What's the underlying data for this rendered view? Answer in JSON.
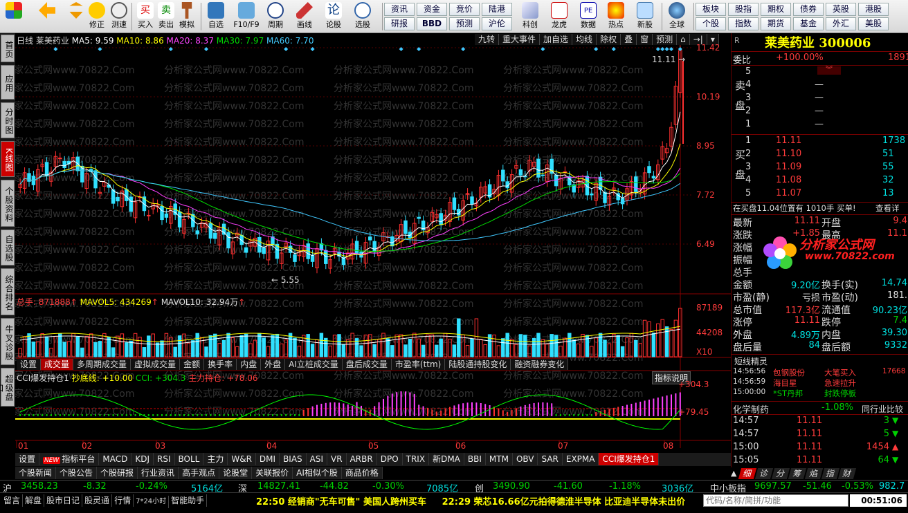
{
  "toolbar": {
    "buttons": [
      "",
      "",
      "修正",
      "测速",
      "买入",
      "卖出",
      "模拟",
      "自选",
      "F10/F9",
      "周期",
      "画线",
      "论股",
      "选股",
      "科创",
      "龙虎",
      "数据",
      "热点",
      "新股",
      "全球"
    ],
    "quick_left": [
      [
        "资讯",
        "资金",
        "竞价",
        "陆港"
      ],
      [
        "研报",
        "BBD",
        "预测",
        "沪伦"
      ]
    ],
    "quick_right": [
      [
        "板块",
        "股指",
        "期权",
        "债券",
        "英股",
        "港股"
      ],
      [
        "个股",
        "指数",
        "期货",
        "基金",
        "外汇",
        "美股"
      ]
    ]
  },
  "left_tabs": [
    "首页",
    "应用",
    "分时图",
    "K线图",
    "个股资料",
    "自选股",
    "综合排名",
    "牛叉诊股",
    "超级盘口"
  ],
  "chart": {
    "period": "日线",
    "stock": "莱美药业",
    "ma": [
      {
        "label": "MA5: 9.59",
        "color": "#ffffff"
      },
      {
        "label": "MA10: 8.86",
        "color": "#ffff00"
      },
      {
        "label": "MA20: 8.37",
        "color": "#ff40ff"
      },
      {
        "label": "MA30: 7.97",
        "color": "#00dd00"
      },
      {
        "label": "MA60: 7.70",
        "color": "#40c8ff"
      }
    ],
    "top_buttons": [
      "九转",
      "重大事件",
      "加自选",
      "均线",
      "除权",
      "叠",
      "窗",
      "预测"
    ],
    "price_axis": [
      "11.42",
      "10.19",
      "8.95",
      "7.72",
      "6.49"
    ],
    "high_label": "11.11",
    "low_label": "5.55",
    "watermark": "分析家公式网www.70822.Com",
    "vol_header": {
      "total": "总手: 871888",
      "mavol5": "MAVOL5: 434269",
      "mavol10": "MAVOL10: 32.94万"
    },
    "vol_axis": [
      "87189",
      "44208",
      "X10"
    ],
    "vol_tabs": [
      "设置",
      "成交量",
      "多周期成交量",
      "虚拟成交量",
      "金额",
      "换手率",
      "内盘",
      "外盘",
      "AI立桩成交量",
      "盘后成交量",
      "市盈率(ttm)",
      "陆股通持股变化",
      "融资融券变化"
    ],
    "ind_header": {
      "name": "CCI爆发持仓1",
      "line": "抄底线: +10.00",
      "cci": "CCI: +304.3",
      "main": "主力持仓: +78.06"
    },
    "ind_button": "指标说明",
    "ind_axis": [
      "+304.3",
      "+79.45"
    ],
    "months": [
      "01",
      "02",
      "03",
      "04",
      "05",
      "06",
      "07",
      "08"
    ]
  },
  "indicator_tabs": [
    "设置",
    "指标平台",
    "MACD",
    "KDJ",
    "RSI",
    "BOLL",
    "主力",
    "W&R",
    "DMI",
    "BIAS",
    "ASI",
    "VR",
    "ARBR",
    "DPO",
    "TRIX",
    "新DMA",
    "BBI",
    "MTM",
    "OBV",
    "SAR",
    "EXPMA",
    "CCI爆发持仓1"
  ],
  "new_badge": "NEW",
  "info_tabs": [
    "个股新闻",
    "个股公告",
    "个股研报",
    "行业资讯",
    "高手观点",
    "论股堂",
    "关联报价",
    "AI相似个股",
    "商品价格"
  ],
  "right": {
    "title": "莱美药业 300006",
    "r_badge": "R",
    "weibi_label": "委比",
    "weibi": "+100.00%",
    "weibi_tail": "1891",
    "sell_label": "卖盘",
    "buy_label": "买盘",
    "sell": [
      {
        "n": "5",
        "p": "",
        "v": ""
      },
      {
        "n": "4",
        "p": "—",
        "v": ""
      },
      {
        "n": "3",
        "p": "—",
        "v": ""
      },
      {
        "n": "2",
        "p": "—",
        "v": ""
      },
      {
        "n": "1",
        "p": "—",
        "v": ""
      }
    ],
    "buy": [
      {
        "n": "1",
        "p": "11.11",
        "v": "1738"
      },
      {
        "n": "2",
        "p": "11.10",
        "v": "51"
      },
      {
        "n": "3",
        "p": "11.09",
        "v": "55"
      },
      {
        "n": "4",
        "p": "11.08",
        "v": "32"
      },
      {
        "n": "5",
        "p": "11.07",
        "v": "13"
      }
    ],
    "queue": "在买盘11.04位置有 1010手 买单!",
    "queue_link": "查看详",
    "stats_left": [
      [
        "最新",
        "11.11"
      ],
      [
        "涨跌",
        "+1.85"
      ],
      [
        "涨幅",
        ""
      ],
      [
        "振幅",
        ""
      ],
      [
        "总手",
        ""
      ],
      [
        "金额",
        "9.20亿"
      ],
      [
        "市盈(静)",
        "亏损"
      ],
      [
        "总市值",
        "117.3亿"
      ],
      [
        "涨停",
        "11.11"
      ],
      [
        "外盘",
        "4.89万"
      ],
      [
        "盘后量",
        "84"
      ]
    ],
    "stats_right": [
      [
        "开盘",
        "9.4"
      ],
      [
        "最高",
        "11.1"
      ],
      [
        "",
        ""
      ],
      [
        "",
        ""
      ],
      [
        "",
        ""
      ],
      [
        "换手(实)",
        "14.74"
      ],
      [
        "市盈(动)",
        "181."
      ],
      [
        "流通值",
        "90.23亿"
      ],
      [
        "跌停",
        "7.4"
      ],
      [
        "内盘",
        "39.30"
      ],
      [
        "盘后额",
        "9332"
      ]
    ],
    "logo_text": "分析家公式网",
    "logo_url": "www.70822.com",
    "short_title": "短线精灵",
    "short_rows": [
      [
        "14:56:56",
        "包钢股份",
        "大笔买入",
        "17668"
      ],
      [
        "14:56:59",
        "海目星",
        "急速拉升",
        ""
      ],
      [
        "15:00:00",
        "*ST丹邦",
        "封跌停板",
        ""
      ]
    ],
    "industry": "化学制药",
    "industry_pct": "-1.08%",
    "industry_link": "同行业比较",
    "ticks": [
      [
        "14:57",
        "11.11",
        "3",
        "down"
      ],
      [
        "14:57",
        "11.11",
        "5",
        "down"
      ],
      [
        "15:00",
        "11.11",
        "1454",
        "up"
      ],
      [
        "15:05",
        "11.11",
        "64",
        "down"
      ]
    ],
    "bottom_tabs": [
      "细",
      "诊",
      "分",
      "筹",
      "焰",
      "指",
      "财"
    ]
  },
  "index_bar": {
    "sh": {
      "label": "沪",
      "val": "3458.23",
      "chg": "-8.32",
      "pct": "-0.24%",
      "amt": "5164亿"
    },
    "sz": {
      "label": "深",
      "val": "14827.41",
      "chg": "-44.82",
      "pct": "-0.30%",
      "amt": "7085亿"
    },
    "cy": {
      "label": "创",
      "val": "3490.90",
      "chg": "-41.60",
      "pct": "-1.18%",
      "amt": "3036亿"
    },
    "zx": {
      "label": "中小板指",
      "val": "9697.57",
      "chg": "-51.46",
      "pct": "-0.53%",
      "amt": "982.7"
    }
  },
  "status": {
    "items": [
      "留言",
      "解盘",
      "股市日记",
      "股灵通",
      "行情",
      "7*24小时",
      "智能助手"
    ],
    "news1": "22:50 经销商\"无车可售\" 美国人跨州买车",
    "news2": "22:29 荣芯16.66亿元拍得德淮半导体 比亚迪半导体未出价",
    "search_placeholder": "代码/名称/简拼/功能",
    "time": "00:51:06"
  }
}
